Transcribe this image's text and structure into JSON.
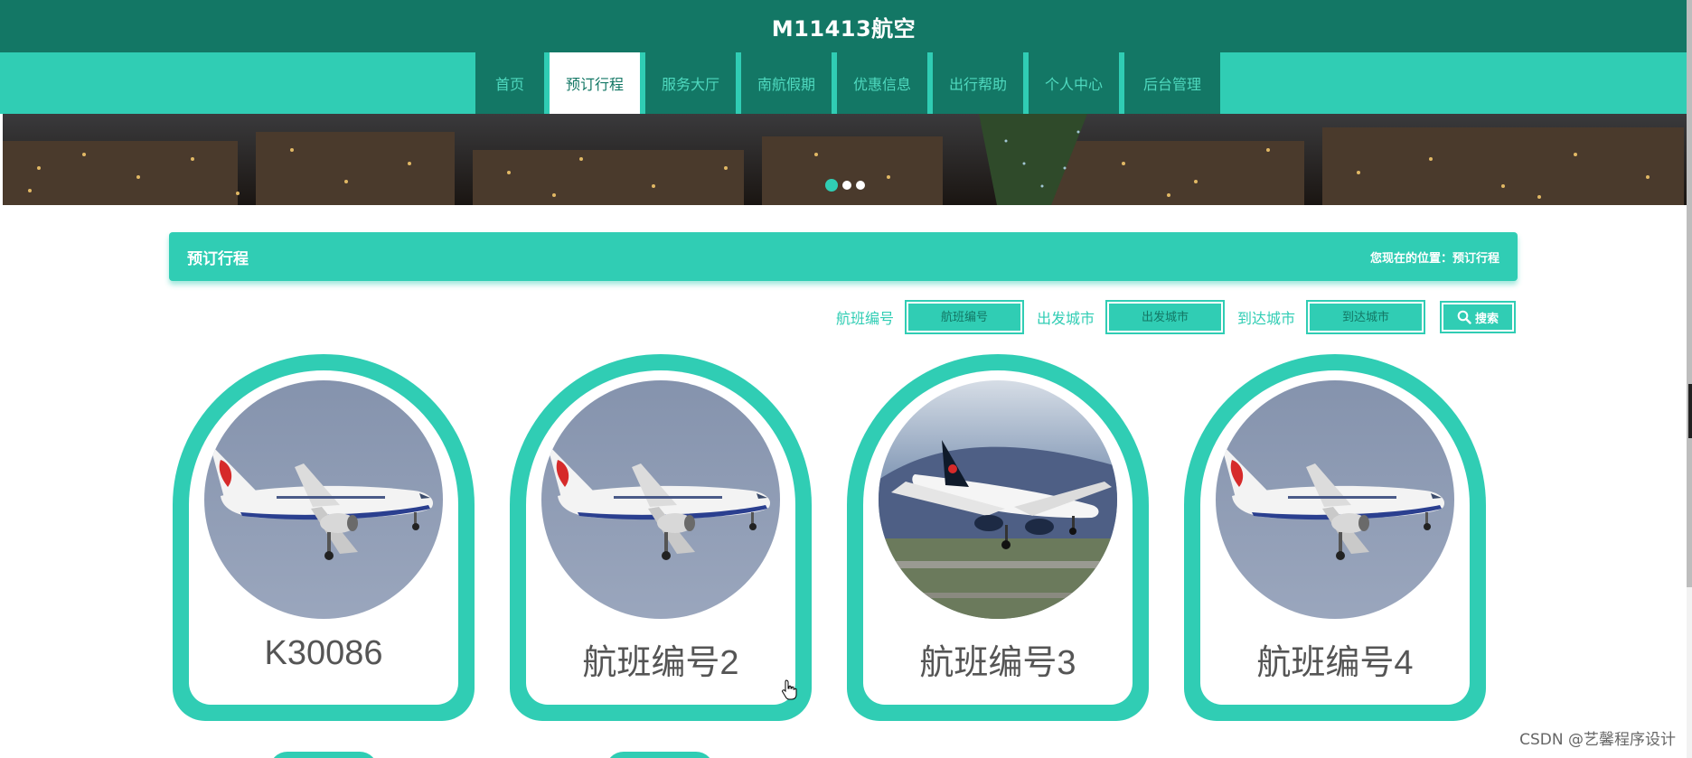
{
  "header": {
    "title": "M11413航空"
  },
  "nav": [
    {
      "label": "首页",
      "width": 76,
      "active": false
    },
    {
      "label": "预订行程",
      "width": 100,
      "active": true
    },
    {
      "label": "服务大厅",
      "width": 100,
      "active": false
    },
    {
      "label": "南航假期",
      "width": 100,
      "active": false
    },
    {
      "label": "优惠信息",
      "width": 100,
      "active": false
    },
    {
      "label": "出行帮助",
      "width": 100,
      "active": false
    },
    {
      "label": "个人中心",
      "width": 100,
      "active": false
    },
    {
      "label": "后台管理",
      "width": 106,
      "active": false
    }
  ],
  "section": {
    "title": "预订行程",
    "breadcrumb": "您现在的位置：预订行程"
  },
  "search": {
    "flight_label": "航班编号",
    "flight_placeholder": "航班编号",
    "from_label": "出发城市",
    "from_placeholder": "出发城市",
    "to_label": "到达城市",
    "to_placeholder": "到达城市",
    "button_label": "搜索"
  },
  "flights": [
    {
      "name": "K30086",
      "image": "air-china-plane"
    },
    {
      "name": "航班编号2",
      "image": "air-china-plane"
    },
    {
      "name": "航班编号3",
      "image": "air-canada-plane"
    },
    {
      "name": "航班编号4",
      "image": "air-china-plane"
    }
  ],
  "colors": {
    "dark_teal": "#137765",
    "teal": "#30cdb4"
  },
  "watermark": "CSDN @艺馨程序设计"
}
